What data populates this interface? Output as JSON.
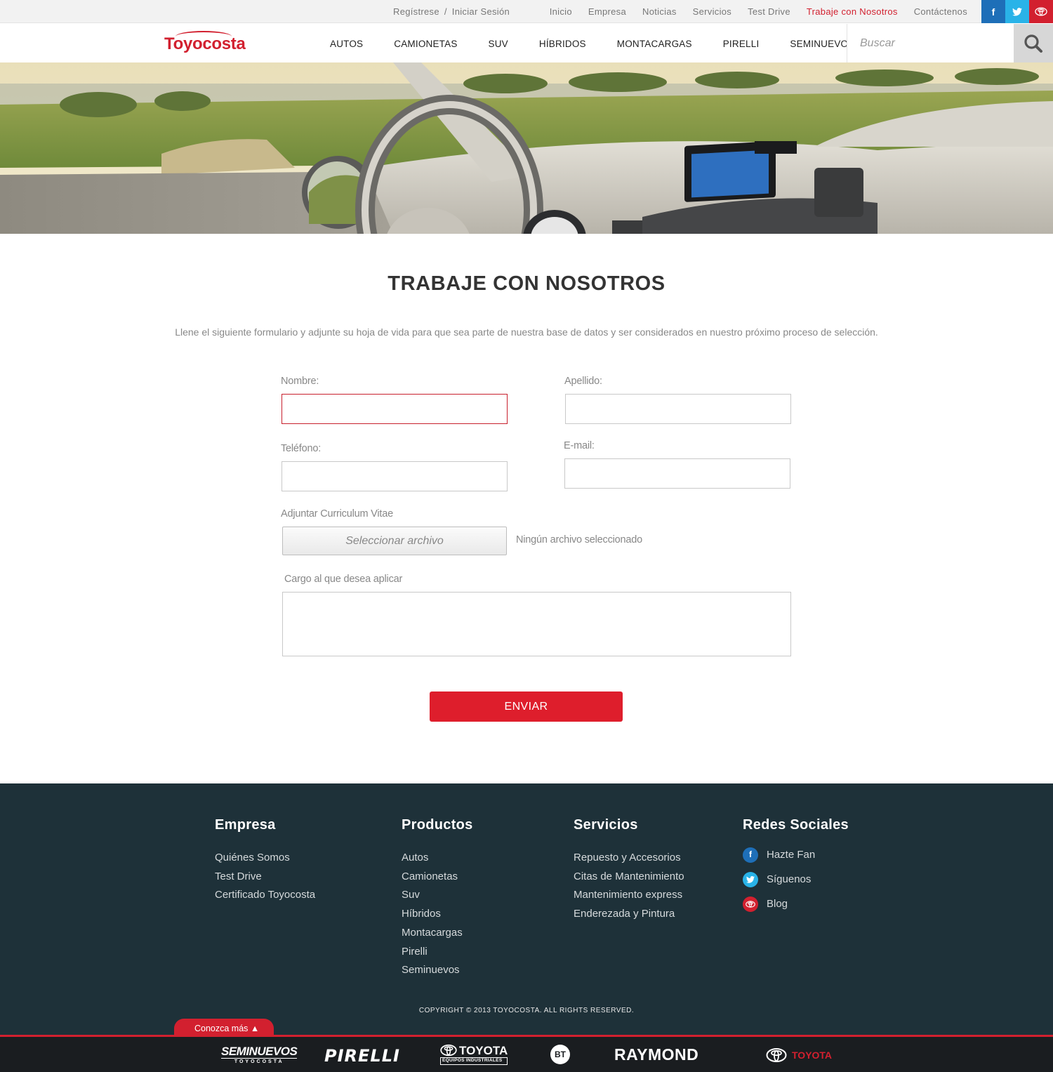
{
  "topbar": {
    "register": "Regístrese",
    "separator": "/",
    "login": "Iniciar Sesión",
    "links": [
      {
        "label": "Inicio",
        "active": false
      },
      {
        "label": "Empresa",
        "active": false
      },
      {
        "label": "Noticias",
        "active": false
      },
      {
        "label": "Servicios",
        "active": false
      },
      {
        "label": "Test Drive",
        "active": false
      },
      {
        "label": "Trabaje con Nosotros",
        "active": true
      },
      {
        "label": "Contáctenos",
        "active": false
      }
    ],
    "social": [
      {
        "icon": "facebook-icon",
        "glyph": "f",
        "color": "#1e6fb8"
      },
      {
        "icon": "twitter-icon",
        "color": "#29b3e8"
      },
      {
        "icon": "toyota-icon",
        "color": "#d2202f"
      }
    ]
  },
  "header": {
    "logo": "Toyocosta",
    "nav": [
      "AUTOS",
      "CAMIONETAS",
      "SUV",
      "HÍBRIDOS",
      "MONTACARGAS",
      "PIRELLI",
      "SEMINUEVOS"
    ],
    "search_placeholder": "Buscar",
    "search_icon": "search-icon"
  },
  "main": {
    "title": "TRABAJE CON NOSOTROS",
    "intro": "Llene el siguiente formulario y adjunte su hoja de vida para que sea parte de nuestra base de datos y ser considerados en nuestro próximo proceso de selección.",
    "form": {
      "nombre_label": "Nombre:",
      "nombre_value": "",
      "apellido_label": "Apellido:",
      "apellido_value": "",
      "telefono_label": "Teléfono:",
      "telefono_value": "",
      "email_label": "E-mail:",
      "email_value": "",
      "cv_label": "Adjuntar Curriculum Vitae",
      "file_button": "Seleccionar archivo",
      "file_status": "Ningún archivo seleccionado",
      "cargo_label": "Cargo al que desea aplicar",
      "cargo_value": "",
      "submit": "ENVIAR"
    }
  },
  "footer": {
    "columns": [
      {
        "title": "Empresa",
        "items": [
          "Quiénes Somos",
          "Test Drive",
          "Certificado Toyocosta"
        ]
      },
      {
        "title": "Productos",
        "items": [
          "Autos",
          "Camionetas",
          "Suv",
          "Híbridos",
          "Montacargas",
          "Pirelli",
          "Seminuevos"
        ]
      },
      {
        "title": "Servicios",
        "items": [
          "Repuesto y Accesorios",
          "Citas de Mantenimiento",
          "Mantenimiento express",
          "Enderezada y Pintura"
        ]
      }
    ],
    "social_title": "Redes Sociales",
    "social": [
      {
        "label": "Hazte Fan",
        "icon": "facebook-icon",
        "glyph": "f",
        "color": "#1e6fb8"
      },
      {
        "label": "Síguenos",
        "icon": "twitter-icon",
        "color": "#29b3e8"
      },
      {
        "label": "Blog",
        "icon": "toyota-icon",
        "color": "#d2202f"
      }
    ],
    "copyright": "COPYRIGHT © 2013 TOYOCOSTA. ALL RIGHTS RESERVED.",
    "more_tab": "Conozca más ▲",
    "brands": {
      "seminuevos": "SEMINUEVOS",
      "seminuevos_sub": "TOYOCOSTA",
      "pirelli": "PIRELLI",
      "toyota_equipos": "TOYOTA",
      "toyota_equipos_sub": "EQUIPOS INDUSTRIALES",
      "bt": "BT",
      "raymond": "RAYMOND",
      "toyota": "TOYOTA"
    }
  },
  "colors": {
    "accent": "#d2202f",
    "footer_bg": "#1e3139",
    "strip_bg": "#1a1d20"
  }
}
